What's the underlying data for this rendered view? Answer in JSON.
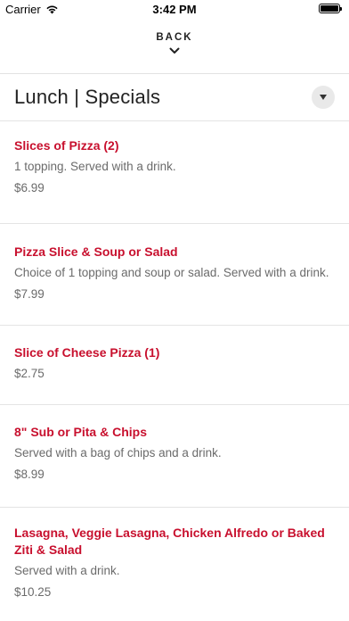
{
  "status_bar": {
    "carrier": "Carrier",
    "time": "3:42 PM",
    "icons": [
      "wifi-icon",
      "battery-icon"
    ]
  },
  "nav": {
    "back_label": "BACK",
    "icon": "chevron-down-icon"
  },
  "section": {
    "title": "Lunch | Specials",
    "dropdown_icon": "caret-down-icon"
  },
  "colors": {
    "item_name": "#c8102e",
    "secondary_text": "#6b6b6b",
    "divider": "#e4e4e4"
  },
  "menu": {
    "items": [
      {
        "name": "Slices of Pizza (2)",
        "description": "1 topping. Served with a drink.",
        "price": "$6.99"
      },
      {
        "name": "Pizza Slice & Soup or Salad",
        "description": "Choice of 1 topping and soup or salad. Served with a drink.",
        "price": "$7.99"
      },
      {
        "name": "Slice of Cheese Pizza (1)",
        "description": "",
        "price": "$2.75"
      },
      {
        "name": "8\" Sub or Pita & Chips",
        "description": "Served with a bag of chips and a drink.",
        "price": "$8.99"
      },
      {
        "name": "Lasagna, Veggie Lasagna, Chicken Alfredo or Baked Ziti & Salad",
        "description": "Served with a drink.",
        "price": "$10.25"
      }
    ]
  }
}
